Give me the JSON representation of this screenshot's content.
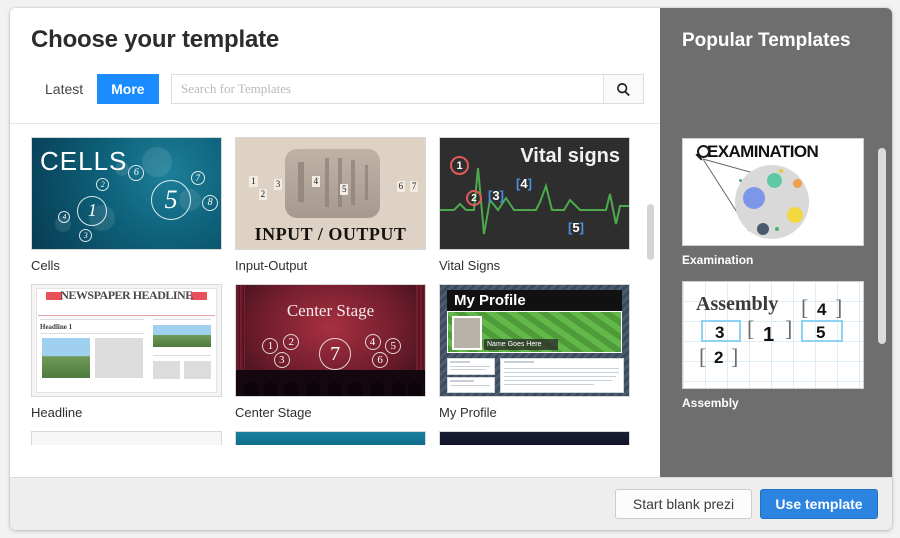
{
  "window": {
    "title": "Choose your template"
  },
  "tabs": [
    {
      "label": "Latest",
      "active": false
    },
    {
      "label": "More",
      "active": true
    }
  ],
  "search": {
    "placeholder": "Search for Templates",
    "value": "",
    "button_icon": "search-icon"
  },
  "colors": {
    "accent_blue": "#1a8cff",
    "primary_button": "#2a84e0",
    "sidebar_bg": "#6e6e6e",
    "footer_bg": "#eeeeee",
    "page_bg": "#f2f2f2"
  },
  "templates": [
    {
      "label": "Cells",
      "title": "CELLS",
      "numbers": [
        "1",
        "2",
        "3",
        "4",
        "5",
        "6",
        "7",
        "8"
      ]
    },
    {
      "label": "Input-Output",
      "title": "INPUT / OUTPUT",
      "numbers": [
        "1",
        "2",
        "3",
        "4",
        "5",
        "6",
        "7"
      ]
    },
    {
      "label": "Vital Signs",
      "title": "Vital signs",
      "numbers": [
        "1",
        "2",
        "3",
        "4",
        "5"
      ]
    },
    {
      "label": "Headline",
      "title": "NEWSPAPER HEADLINE",
      "subtitle": "Headline 1"
    },
    {
      "label": "Center Stage",
      "title": "Center Stage",
      "numbers": [
        "1",
        "2",
        "3",
        "4",
        "5",
        "6",
        "7"
      ]
    },
    {
      "label": "My Profile",
      "title": "My Profile",
      "subtitle": "Name Goes Here"
    }
  ],
  "sidebar": {
    "title": "Popular Templates",
    "items": [
      {
        "label": "Examination",
        "title": "EXAMINATION"
      },
      {
        "label": "Assembly",
        "title": "Assembly",
        "numbers": [
          "1",
          "2",
          "3",
          "4",
          "5"
        ]
      }
    ]
  },
  "footer": {
    "blank_label": "Start blank prezi",
    "use_label": "Use template"
  }
}
